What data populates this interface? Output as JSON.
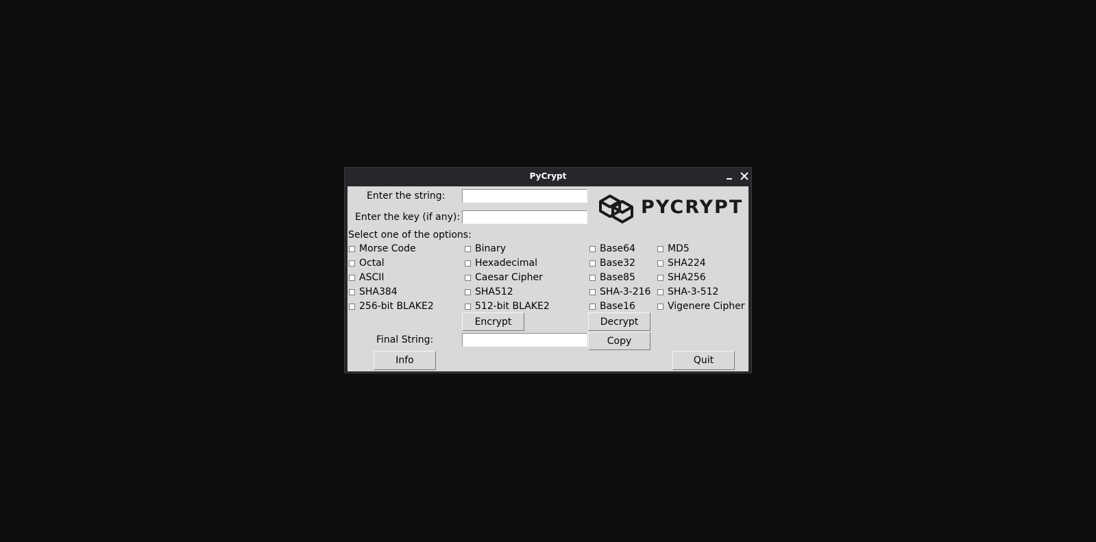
{
  "window": {
    "title": "PyCrypt"
  },
  "form": {
    "string_label": "Enter the string:",
    "string_value": "",
    "key_label": "Enter the key (if any):",
    "key_value": "",
    "options_label": "Select one of the options:",
    "final_label": "Final String:",
    "final_value": ""
  },
  "logo": {
    "text": "PYCRYPT",
    "icon": "hexagon-cube-logo"
  },
  "options": [
    [
      "Morse Code",
      "Binary",
      "Base64",
      "MD5"
    ],
    [
      "Octal",
      "Hexadecimal",
      "Base32",
      "SHA224"
    ],
    [
      "ASCII",
      "Caesar Cipher",
      "Base85",
      "SHA256"
    ],
    [
      "SHA384",
      "SHA512",
      "SHA-3-216",
      "SHA-3-512"
    ],
    [
      "256-bit BLAKE2",
      "512-bit BLAKE2",
      "Base16",
      "Vigenere Cipher"
    ]
  ],
  "buttons": {
    "encrypt": "Encrypt",
    "decrypt": "Decrypt",
    "copy": "Copy",
    "info": "Info",
    "quit": "Quit"
  },
  "colors": {
    "desktop": "#0e0e0e",
    "titlebar": "#26272b",
    "client": "#d9d9d9"
  }
}
